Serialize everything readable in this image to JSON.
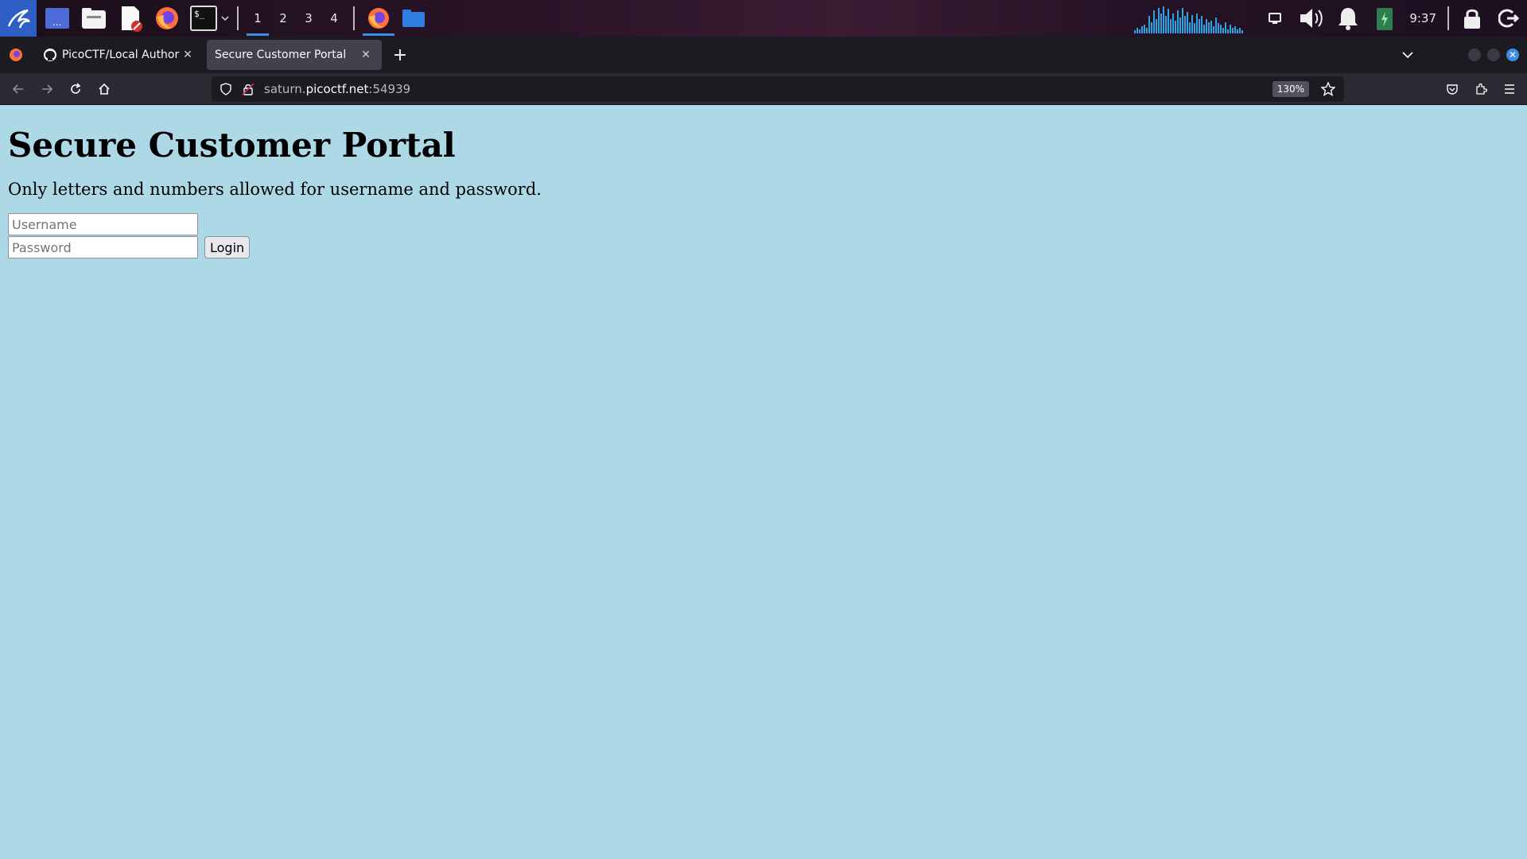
{
  "panel": {
    "workspaces": [
      "1",
      "2",
      "3",
      "4"
    ],
    "active_workspace": "1",
    "clock": "9:37",
    "accent": "#3a8ee6",
    "cpu_levels": [
      0.1,
      0.2,
      0.15,
      0.25,
      0.3,
      0.2,
      0.6,
      0.4,
      0.8,
      0.5,
      0.9,
      0.7,
      0.95,
      0.6,
      0.85,
      0.5,
      0.7,
      0.45,
      0.8,
      0.55,
      0.9,
      0.6,
      0.75,
      0.4,
      0.65,
      0.35,
      0.7,
      0.5,
      0.6,
      0.3,
      0.5,
      0.4,
      0.45,
      0.25,
      0.55,
      0.35,
      0.3,
      0.2,
      0.4,
      0.15,
      0.3,
      0.2,
      0.25,
      0.15,
      0.2,
      0.1
    ]
  },
  "browser": {
    "tabs": [
      {
        "title": "PicoCTF/Local Authority/R",
        "active": false,
        "icon": "github-icon"
      },
      {
        "title": "Secure Customer Portal",
        "active": true,
        "icon": ""
      }
    ],
    "url_host": "saturn.",
    "url_domain": "picoctf.net",
    "url_port": ":54939",
    "zoom": "130%"
  },
  "page": {
    "title": "Secure Customer Portal",
    "note": "Only letters and numbers allowed for username and password.",
    "username_placeholder": "Username",
    "password_placeholder": "Password",
    "login_label": "Login",
    "background": "#add8e6"
  }
}
